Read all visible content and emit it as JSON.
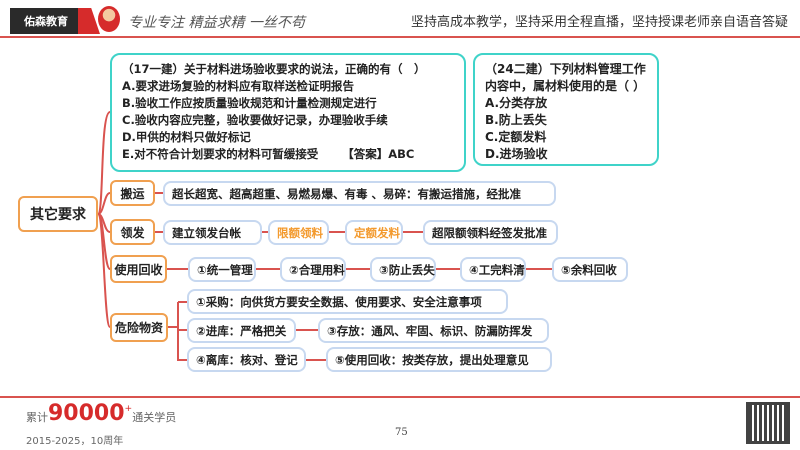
{
  "header": {
    "logo_text": "佑森教育",
    "slogan": "专业专注 精益求精 一丝不苟",
    "tagline": "坚持高成本教学，坚持采用全程直播，坚持授课老师亲自语音答疑"
  },
  "question1": {
    "title": "（17一建）关于材料进场验收要求的说法，正确的有（　）",
    "options": [
      "A.要求进场复验的材料应有取样送检证明报告",
      "B.验收工作应按质量验收规范和计量检测规定进行",
      "C.验收内容应完整，验收要做好记录，办理验收手续",
      "D.甲供的材料只做好标记",
      "E.对不符合计划要求的材料可暂缓接受"
    ],
    "answer": "【答案】ABC"
  },
  "question2": {
    "title_lines": [
      "（24二建）下列材料管理工作",
      "内容中，属材料使用的是（ ）"
    ],
    "options": [
      "A.分类存放",
      "B.防上丢失",
      "C.定额发料",
      "D.进场验收"
    ]
  },
  "mindmap": {
    "root": "其它要求",
    "transport": {
      "label": "搬运",
      "content": "超长超宽、超高超重、易燃易爆、有毒 、易碎：有搬运措施，经批准"
    },
    "issue": {
      "label": "领发",
      "items": [
        "建立领发台帐",
        "限额领料",
        "定额发料",
        "超限额领料经签发批准"
      ]
    },
    "recycle": {
      "label": "使用回收",
      "items": [
        "①统一管理",
        "②合理用料",
        "③防止丢失",
        "④工完料清",
        "⑤余料回收"
      ]
    },
    "hazard": {
      "label": "危险物资",
      "items": [
        "①采购：向供货方要安全数据、使用要求、安全注意事项",
        "②进库：严格把关",
        "③存放：通风、牢固、标识、防漏防挥发",
        "④离库：核对、登记",
        "⑤使用回收：按类存放，提出处理意见"
      ]
    }
  },
  "footer": {
    "prefix": "累计",
    "count": "90000",
    "plus": "+",
    "suffix": "通关学员",
    "years": "2015-2025，10周年",
    "page": "75"
  },
  "colors": {
    "accent": "#d9534f",
    "question_border": "#3fd3c9",
    "node_border": "#f0a050",
    "highlight": "#f39a2e"
  }
}
